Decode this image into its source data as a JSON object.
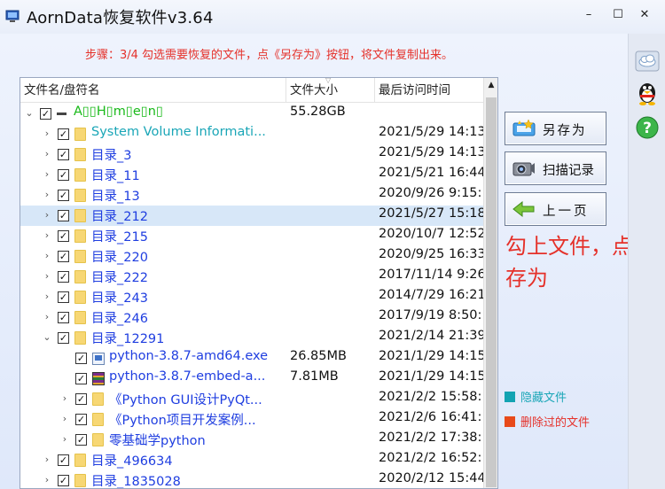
{
  "window": {
    "title": "AornData恢复软件v3.64",
    "minimize_glyph": "–",
    "maximize_glyph": "☐",
    "close_glyph": "✕"
  },
  "instruction": "步骤：3/4 勾选需要恢复的文件，点《另存为》按钮，将文件复制出来。",
  "columns": {
    "name": "文件名/盘符名",
    "size": "文件大小",
    "time": "最后访问时间"
  },
  "tree": [
    {
      "depth": 0,
      "expanded": true,
      "checked": true,
      "icon": "drive-icon",
      "label": "A▯▯H▯m▯e▯n▯",
      "color": "green",
      "size": "55.28GB",
      "time": ""
    },
    {
      "depth": 1,
      "expanded": false,
      "checked": true,
      "icon": "folder-icon",
      "label": "System Volume Informati...",
      "color": "teal",
      "size": "",
      "time": "2021/5/29 14:13"
    },
    {
      "depth": 1,
      "expanded": false,
      "checked": true,
      "icon": "folder-icon",
      "label": "目录_3",
      "color": "blue",
      "size": "",
      "time": "2021/5/29 14:13"
    },
    {
      "depth": 1,
      "expanded": false,
      "checked": true,
      "icon": "folder-icon",
      "label": "目录_11",
      "color": "blue",
      "size": "",
      "time": "2021/5/21 16:44"
    },
    {
      "depth": 1,
      "expanded": false,
      "checked": true,
      "icon": "folder-icon",
      "label": "目录_13",
      "color": "blue",
      "size": "",
      "time": "2020/9/26 9:15:"
    },
    {
      "depth": 1,
      "expanded": false,
      "checked": true,
      "icon": "folder-icon",
      "label": "目录_212",
      "color": "blue",
      "size": "",
      "time": "2021/5/27 15:18",
      "selected": true
    },
    {
      "depth": 1,
      "expanded": false,
      "checked": true,
      "icon": "folder-icon",
      "label": "目录_215",
      "color": "blue",
      "size": "",
      "time": "2020/10/7 12:52"
    },
    {
      "depth": 1,
      "expanded": false,
      "checked": true,
      "icon": "folder-icon",
      "label": "目录_220",
      "color": "blue",
      "size": "",
      "time": "2020/9/25 16:33"
    },
    {
      "depth": 1,
      "expanded": false,
      "checked": true,
      "icon": "folder-icon",
      "label": "目录_222",
      "color": "blue",
      "size": "",
      "time": "2017/11/14 9:26"
    },
    {
      "depth": 1,
      "expanded": false,
      "checked": true,
      "icon": "folder-icon",
      "label": "目录_243",
      "color": "blue",
      "size": "",
      "time": "2014/7/29 16:21"
    },
    {
      "depth": 1,
      "expanded": false,
      "checked": true,
      "icon": "folder-icon",
      "label": "目录_246",
      "color": "blue",
      "size": "",
      "time": "2017/9/19 8:50:"
    },
    {
      "depth": 1,
      "expanded": true,
      "checked": true,
      "icon": "folder-icon",
      "label": "目录_12291",
      "color": "blue",
      "size": "",
      "time": "2021/2/14 21:39"
    },
    {
      "depth": 2,
      "leaf": true,
      "checked": true,
      "icon": "exe-icon",
      "label": "python-3.8.7-amd64.exe",
      "color": "blue",
      "size": "26.85MB",
      "time": "2021/1/29 14:15"
    },
    {
      "depth": 2,
      "leaf": true,
      "checked": true,
      "icon": "zip-icon",
      "label": "python-3.8.7-embed-a...",
      "color": "blue",
      "size": "7.81MB",
      "time": "2021/1/29 14:15"
    },
    {
      "depth": 2,
      "expanded": false,
      "checked": true,
      "icon": "folder-icon",
      "label": "《Python GUI设计PyQt...",
      "color": "blue",
      "size": "",
      "time": "2021/2/2 15:58:"
    },
    {
      "depth": 2,
      "expanded": false,
      "checked": true,
      "icon": "folder-icon",
      "label": "《Python项目开发案例...",
      "color": "blue",
      "size": "",
      "time": "2021/2/6 16:41:"
    },
    {
      "depth": 2,
      "expanded": false,
      "checked": true,
      "icon": "folder-icon",
      "label": "零基础学python",
      "color": "blue",
      "size": "",
      "time": "2021/2/2 17:38:"
    },
    {
      "depth": 1,
      "expanded": false,
      "checked": true,
      "icon": "folder-icon",
      "label": "目录_496634",
      "color": "blue",
      "size": "",
      "time": "2021/2/2 16:52:"
    },
    {
      "depth": 1,
      "expanded": false,
      "checked": true,
      "icon": "folder-icon",
      "label": "目录_1835028",
      "color": "blue",
      "size": "",
      "time": "2020/2/12 15:44"
    }
  ],
  "buttons": {
    "save_as": "另存为",
    "scan_log": "扫描记录",
    "back": "上一页"
  },
  "annotation": "勾上文件，点另存为",
  "legend": {
    "hidden": "隐藏文件",
    "deleted": "删除过的文件"
  },
  "colors": {
    "hidden": "#13a3b2",
    "deleted": "#e84a1a",
    "instruction": "#e5312a",
    "folder_text": "#1f3ee0",
    "drive_text": "#18b918"
  },
  "glyphs": {
    "expanded": "⌄",
    "collapsed": "›",
    "checked": "✓",
    "scroll_up": "▲"
  }
}
